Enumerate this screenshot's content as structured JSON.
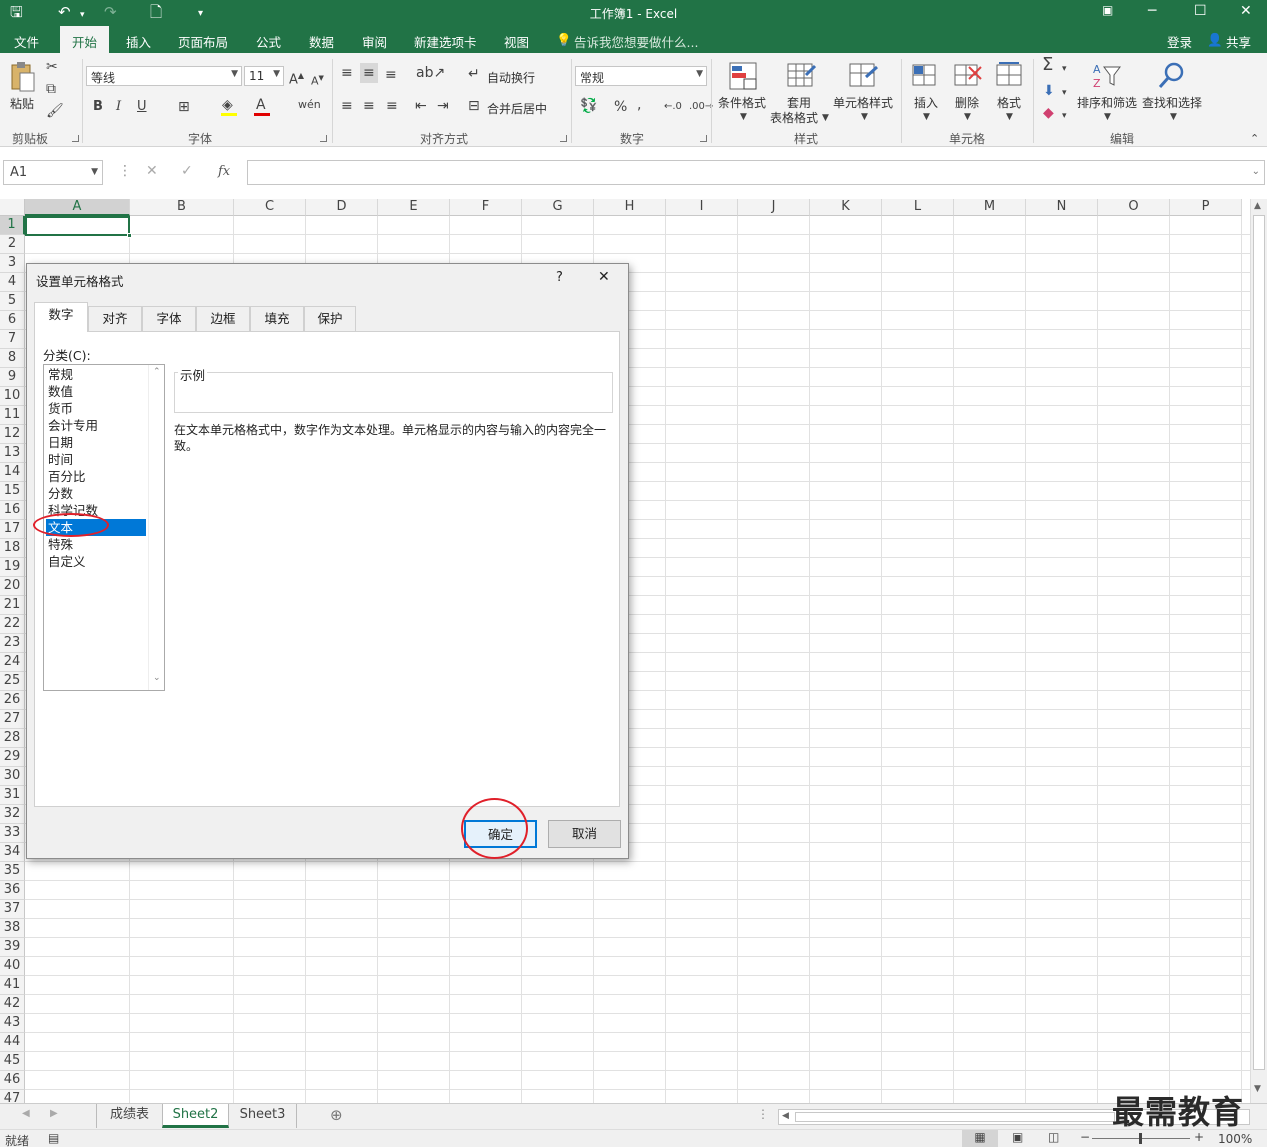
{
  "window": {
    "title": "工作簿1 - Excel"
  },
  "ribbon_tabs": [
    "文件",
    "开始",
    "插入",
    "页面布局",
    "公式",
    "数据",
    "审阅",
    "新建选项卡",
    "视图"
  ],
  "active_tab": "开始",
  "tell_me": "告诉我您想要做什么...",
  "account": {
    "signin": "登录",
    "share": "共享"
  },
  "clipboard": {
    "paste": "粘贴",
    "group": "剪贴板"
  },
  "font": {
    "name": "等线",
    "size": "11",
    "group": "字体",
    "bold": "B",
    "italic": "I",
    "underline": "U"
  },
  "alignment": {
    "wrap": "自动换行",
    "merge": "合并后居中",
    "group": "对齐方式"
  },
  "number": {
    "format": "常规",
    "group": "数字"
  },
  "styles": {
    "conditional": "条件格式",
    "table_line1": "套用",
    "table_line2": "表格格式",
    "cell_styles": "单元格样式",
    "group": "样式"
  },
  "cells": {
    "insert": "插入",
    "delete": "删除",
    "format": "格式",
    "group": "单元格"
  },
  "editing": {
    "sort": "排序和筛选",
    "find": "查找和选择",
    "group": "编辑"
  },
  "formula_bar": {
    "name_box": "A1",
    "fx": "fx"
  },
  "columns": [
    "A",
    "B",
    "C",
    "D",
    "E",
    "F",
    "G",
    "H",
    "I",
    "J",
    "K",
    "L",
    "M",
    "N",
    "O",
    "P"
  ],
  "rows": [
    "1",
    "2",
    "3",
    "4",
    "5",
    "6",
    "7",
    "8",
    "9",
    "10",
    "11",
    "12",
    "13",
    "14",
    "15",
    "16",
    "17",
    "18",
    "19",
    "20",
    "21",
    "22",
    "23",
    "24",
    "25",
    "26",
    "27",
    "28",
    "29",
    "30",
    "31",
    "32",
    "33",
    "34",
    "35",
    "36",
    "37",
    "38",
    "39",
    "40",
    "41",
    "42",
    "43",
    "44",
    "45",
    "46",
    "47"
  ],
  "sheets": [
    "成绩表",
    "Sheet2",
    "Sheet3"
  ],
  "active_sheet": "Sheet2",
  "status": {
    "ready": "就绪",
    "zoom": "100%"
  },
  "watermark": "最需教育",
  "dialog": {
    "title": "设置单元格格式",
    "help": "?",
    "close": "✕",
    "tabs": [
      "数字",
      "对齐",
      "字体",
      "边框",
      "填充",
      "保护"
    ],
    "active_tab": "数字",
    "category_label": "分类(C):",
    "categories": [
      "常规",
      "数值",
      "货币",
      "会计专用",
      "日期",
      "时间",
      "百分比",
      "分数",
      "科学记数",
      "文本",
      "特殊",
      "自定义"
    ],
    "selected_category": "文本",
    "sample_label": "示例",
    "description": "在文本单元格格式中，数字作为文本处理。单元格显示的内容与输入的内容完全一致。",
    "ok": "确定",
    "cancel": "取消"
  },
  "colors": {
    "excel_green": "#217346",
    "selection_blue": "#0078d7",
    "annotation_red": "#e0202a"
  }
}
